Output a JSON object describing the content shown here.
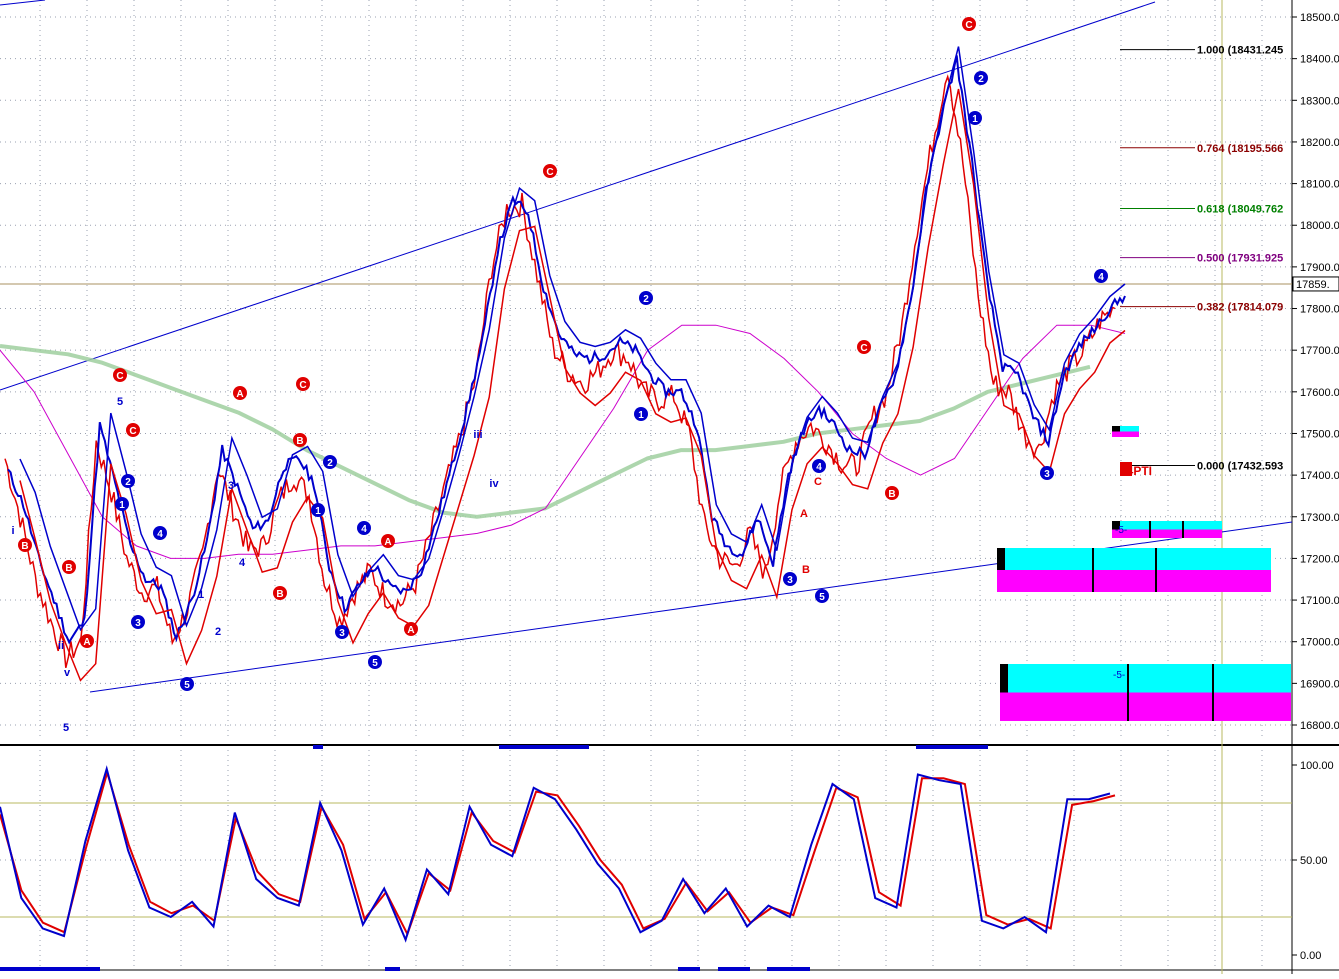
{
  "chart_data": [
    {
      "type": "line",
      "title": "",
      "price_axis": {
        "ticks": [
          "18500.00",
          "18400.00",
          "18300.00",
          "18200.00",
          "18100.00",
          "18000.00",
          "17900.00",
          "17800.00",
          "17700.00",
          "17600.00",
          "17500.00",
          "17400.00",
          "17300.00",
          "17200.00",
          "17100.00",
          "17000.00",
          "16900.00",
          "16800.00"
        ],
        "ylim": [
          16780,
          18520
        ],
        "current_price_label": "17859.",
        "current_price": 17859
      },
      "grid": true,
      "series": [
        {
          "color": "#e00000",
          "values": [
            17440,
            17300,
            17150,
            17050,
            16960,
            17000,
            17480,
            17360,
            17200,
            17120,
            17130,
            17000,
            17080,
            17210,
            17420,
            17320,
            17220,
            17230,
            17340,
            17400,
            17350,
            17150,
            17050,
            17120,
            17170,
            17110,
            17090,
            17140,
            17260,
            17380,
            17500,
            17640,
            17900,
            18040,
            18050,
            17880,
            17710,
            17650,
            17620,
            17650,
            17700,
            17680,
            17600,
            17580,
            17590,
            17500,
            17280,
            17200,
            17180,
            17260,
            17160,
            17370,
            17480,
            17520,
            17480,
            17430,
            17420,
            17530,
            17600,
            17760,
            18000,
            18200,
            18380,
            18150,
            17830,
            17620,
            17600,
            17500,
            17460,
            17600,
            17660,
            17700,
            17770,
            17800
          ]
        },
        {
          "color": "#0000cc",
          "values": [
            17410,
            17330,
            17200,
            17100,
            17000,
            17050,
            17520,
            17380,
            17230,
            17150,
            17130,
            17010,
            17100,
            17240,
            17460,
            17370,
            17270,
            17290,
            17420,
            17440,
            17380,
            17180,
            17080,
            17140,
            17180,
            17130,
            17120,
            17170,
            17290,
            17420,
            17560,
            17720,
            17940,
            18060,
            18030,
            17850,
            17740,
            17690,
            17680,
            17690,
            17720,
            17700,
            17640,
            17600,
            17600,
            17520,
            17300,
            17230,
            17210,
            17300,
            17190,
            17400,
            17510,
            17560,
            17520,
            17460,
            17450,
            17560,
            17640,
            17820,
            18080,
            18260,
            18400,
            18150,
            17860,
            17660,
            17640,
            17540,
            17480,
            17640,
            17710,
            17750,
            17800,
            17830
          ]
        },
        {
          "color": "#000000",
          "values": []
        },
        {
          "color": "#9fcf9f",
          "values": [
            17710,
            17700,
            17690,
            17670,
            17640,
            17610,
            17580,
            17550,
            17510,
            17460,
            17420,
            17380,
            17340,
            17310,
            17300,
            17310,
            17320,
            17360,
            17400,
            17440,
            17460,
            17460,
            17470,
            17480,
            17500,
            17510,
            17520,
            17530,
            17560,
            17600,
            17620,
            17640,
            17660
          ]
        },
        {
          "color": "#cc00cc",
          "values": [
            17700,
            17600,
            17450,
            17300,
            17230,
            17200,
            17200,
            17210,
            17210,
            17220,
            17230,
            17230,
            17240,
            17250,
            17260,
            17280,
            17320,
            17440,
            17560,
            17700,
            17760,
            17760,
            17740,
            17680,
            17600,
            17500,
            17440,
            17400,
            17440,
            17560,
            17680,
            17760,
            17760,
            17740
          ]
        }
      ],
      "fib_levels": [
        {
          "label": "1.000 (18431.245",
          "value": 18431.245,
          "color": "#000000"
        },
        {
          "label": "0.764 (18195.566",
          "value": 18195.566,
          "color": "#8b0000"
        },
        {
          "label": "0.618 (18049.762",
          "value": 18049.762,
          "color": "#008000"
        },
        {
          "label": "0.500 (17931.925",
          "value": 17931.925,
          "color": "#800080"
        },
        {
          "label": "0.382 (17814.079",
          "value": 17814.079,
          "color": "#8b0000"
        },
        {
          "label": "0.000 (17432.593",
          "value": 17432.593,
          "color": "#000000"
        }
      ],
      "annotations": [
        "74PTI",
        "-5-",
        "-5-"
      ],
      "wave_labels_red_circled": [
        "C",
        "A",
        "C",
        "B",
        "C",
        "C",
        "A",
        "B",
        "A",
        "C",
        "B",
        "A",
        "B",
        "C",
        "B"
      ],
      "wave_labels_blue_circled": [
        "1",
        "2",
        "3",
        "4",
        "5",
        "1",
        "2",
        "3",
        "4",
        "5",
        "1",
        "2",
        "3",
        "4",
        "5",
        "1",
        "2",
        "3",
        "4"
      ],
      "wave_labels_plain": [
        "5",
        "v",
        "ii",
        "i",
        "iii",
        "iv",
        "1",
        "2",
        "3",
        "4",
        "5",
        "A",
        "B",
        "C"
      ]
    },
    {
      "type": "line",
      "title": "",
      "price_axis": {
        "ticks": [
          "100.00",
          "50.00",
          "0.00"
        ],
        "ylim": [
          0,
          100
        ]
      },
      "reference_lines": [
        80,
        20
      ],
      "series": [
        {
          "color": "#0000cc",
          "values": [
            78,
            30,
            14,
            10,
            60,
            98,
            55,
            25,
            20,
            28,
            15,
            75,
            40,
            30,
            26,
            80,
            55,
            16,
            35,
            8,
            45,
            32,
            78,
            58,
            52,
            88,
            82,
            66,
            48,
            35,
            12,
            18,
            40,
            22,
            35,
            15,
            26,
            20,
            58,
            90,
            82,
            30,
            25,
            95,
            92,
            90,
            18,
            14,
            20,
            12,
            82,
            82,
            85
          ]
        },
        {
          "color": "#e00000",
          "values": [
            74,
            34,
            17,
            12,
            56,
            96,
            58,
            28,
            22,
            26,
            18,
            72,
            44,
            32,
            28,
            78,
            58,
            19,
            33,
            11,
            43,
            34,
            75,
            60,
            54,
            86,
            84,
            68,
            50,
            37,
            14,
            19,
            38,
            23,
            33,
            17,
            25,
            21,
            55,
            88,
            83,
            33,
            26,
            93,
            93,
            90,
            21,
            16,
            19,
            14,
            79,
            81,
            84
          ]
        }
      ]
    }
  ]
}
